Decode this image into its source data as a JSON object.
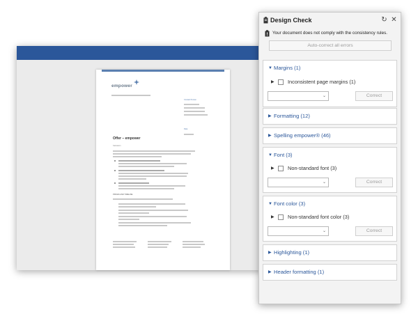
{
  "document": {
    "logo_text": "empower",
    "contact_heading": "Contact Person",
    "date_label": "Date",
    "title": "Offer – empower",
    "greeting": "Salutation",
    "section_heading": "PRICES AND TIMELINE"
  },
  "panel": {
    "title": "Design Check",
    "warning_text": "Your document does not comply with the consistency rules.",
    "autocorrect_label": "Auto-correct all errors",
    "sections": [
      {
        "title": "Margins (1)",
        "expanded": true,
        "item_label": "Inconsistent page margins (1)",
        "correct_label": "Correct"
      },
      {
        "title": "Formatting (12)",
        "expanded": false
      },
      {
        "title": "Spelling empower® (46)",
        "expanded": false
      },
      {
        "title": "Font (3)",
        "expanded": true,
        "item_label": "Non-standard font (3)",
        "correct_label": "Correct"
      },
      {
        "title": "Font color (3)",
        "expanded": true,
        "item_label": "Non-standard font color (3)",
        "correct_label": "Correct"
      },
      {
        "title": "Highlighting (1)",
        "expanded": false
      },
      {
        "title": "Header formatting (1)",
        "expanded": false
      }
    ]
  },
  "colors": {
    "accent": "#2b579a",
    "ribbon": "#2b579a"
  }
}
